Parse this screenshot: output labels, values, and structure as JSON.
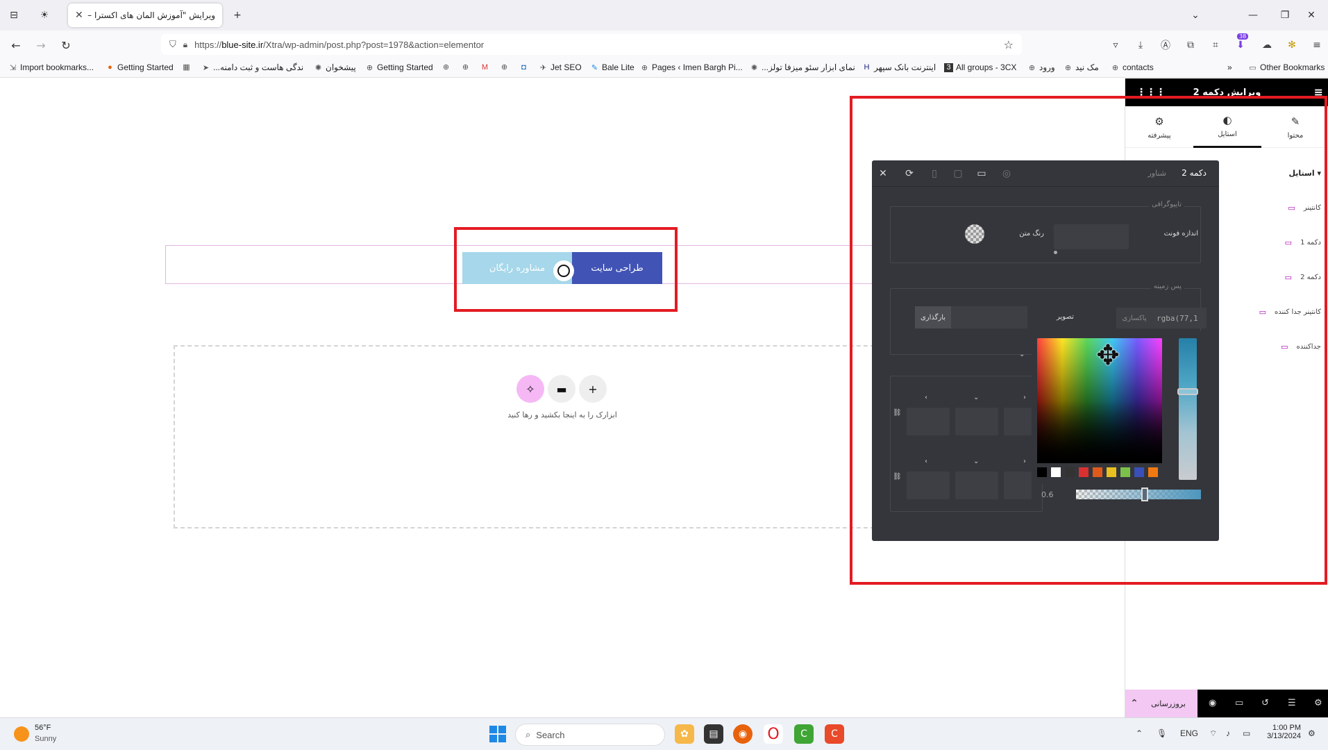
{
  "browser": {
    "tab_title": "ویرایش \"آموزش المان های اکسترا – ...",
    "url_prefix": "https://",
    "url_domain": "blue-site.ir",
    "url_path": "/Xtra/wp-admin/post.php?post=1978&action=elementor",
    "extension_badge": "38"
  },
  "bookmarks": [
    "Import bookmarks...",
    "Getting Started",
    "...ندگی هاست و ثبت دامنه",
    "پیشخوان",
    "Getting Started",
    "Jet SEO",
    "Bale Lite",
    "Pages ‹ Imen Bargh Pi...",
    "...نمای ابزار سئو میزفا تولز",
    "اینترنت بانک سپهر",
    "All groups - 3CX",
    "ورود",
    "مک نید",
    "contacts"
  ],
  "other_bookmarks": "Other Bookmarks",
  "canvas": {
    "btn_site": "طراحی سایت",
    "btn_free": "مشاوره رایگان",
    "drop_hint": "ابزارک را به اینجا بکشید و رها کنید"
  },
  "panel": {
    "title": "ویرایش دکمه 2",
    "tabs": {
      "content": "محتوا",
      "style": "استایل",
      "advanced": "پیشرفته"
    },
    "style_section": "استایل",
    "navigator": [
      "کانتینر",
      "دکمه 1",
      "دکمه 2",
      "کانتینر جدا کننده",
      "جداکننده"
    ],
    "update_label": "بروزرسانی"
  },
  "dialog": {
    "title": "دکمه 2",
    "subtitle": "شناور",
    "typography_label": "تایپوگرافی",
    "font_size_label": "اندازه فونت",
    "text_color_label": "رنگ متن",
    "background_label": "پس زمینه",
    "image_label": "تصویر",
    "upload_label": "بارگذاری",
    "clear_label": "پاکسازی",
    "rgba_value": "rgba(77,1",
    "alpha_value": "0.6",
    "swatches": [
      "#000000",
      "#ffffff",
      "#333333",
      "#d93030",
      "#e05a1c",
      "#e8c020",
      "#7cc24a",
      "#3a4fb8",
      "#f07a10"
    ]
  },
  "taskbar": {
    "temp": "56°F",
    "condition": "Sunny",
    "search_placeholder": "Search",
    "lang": "ENG",
    "time": "1:00 PM",
    "date": "3/13/2024"
  }
}
